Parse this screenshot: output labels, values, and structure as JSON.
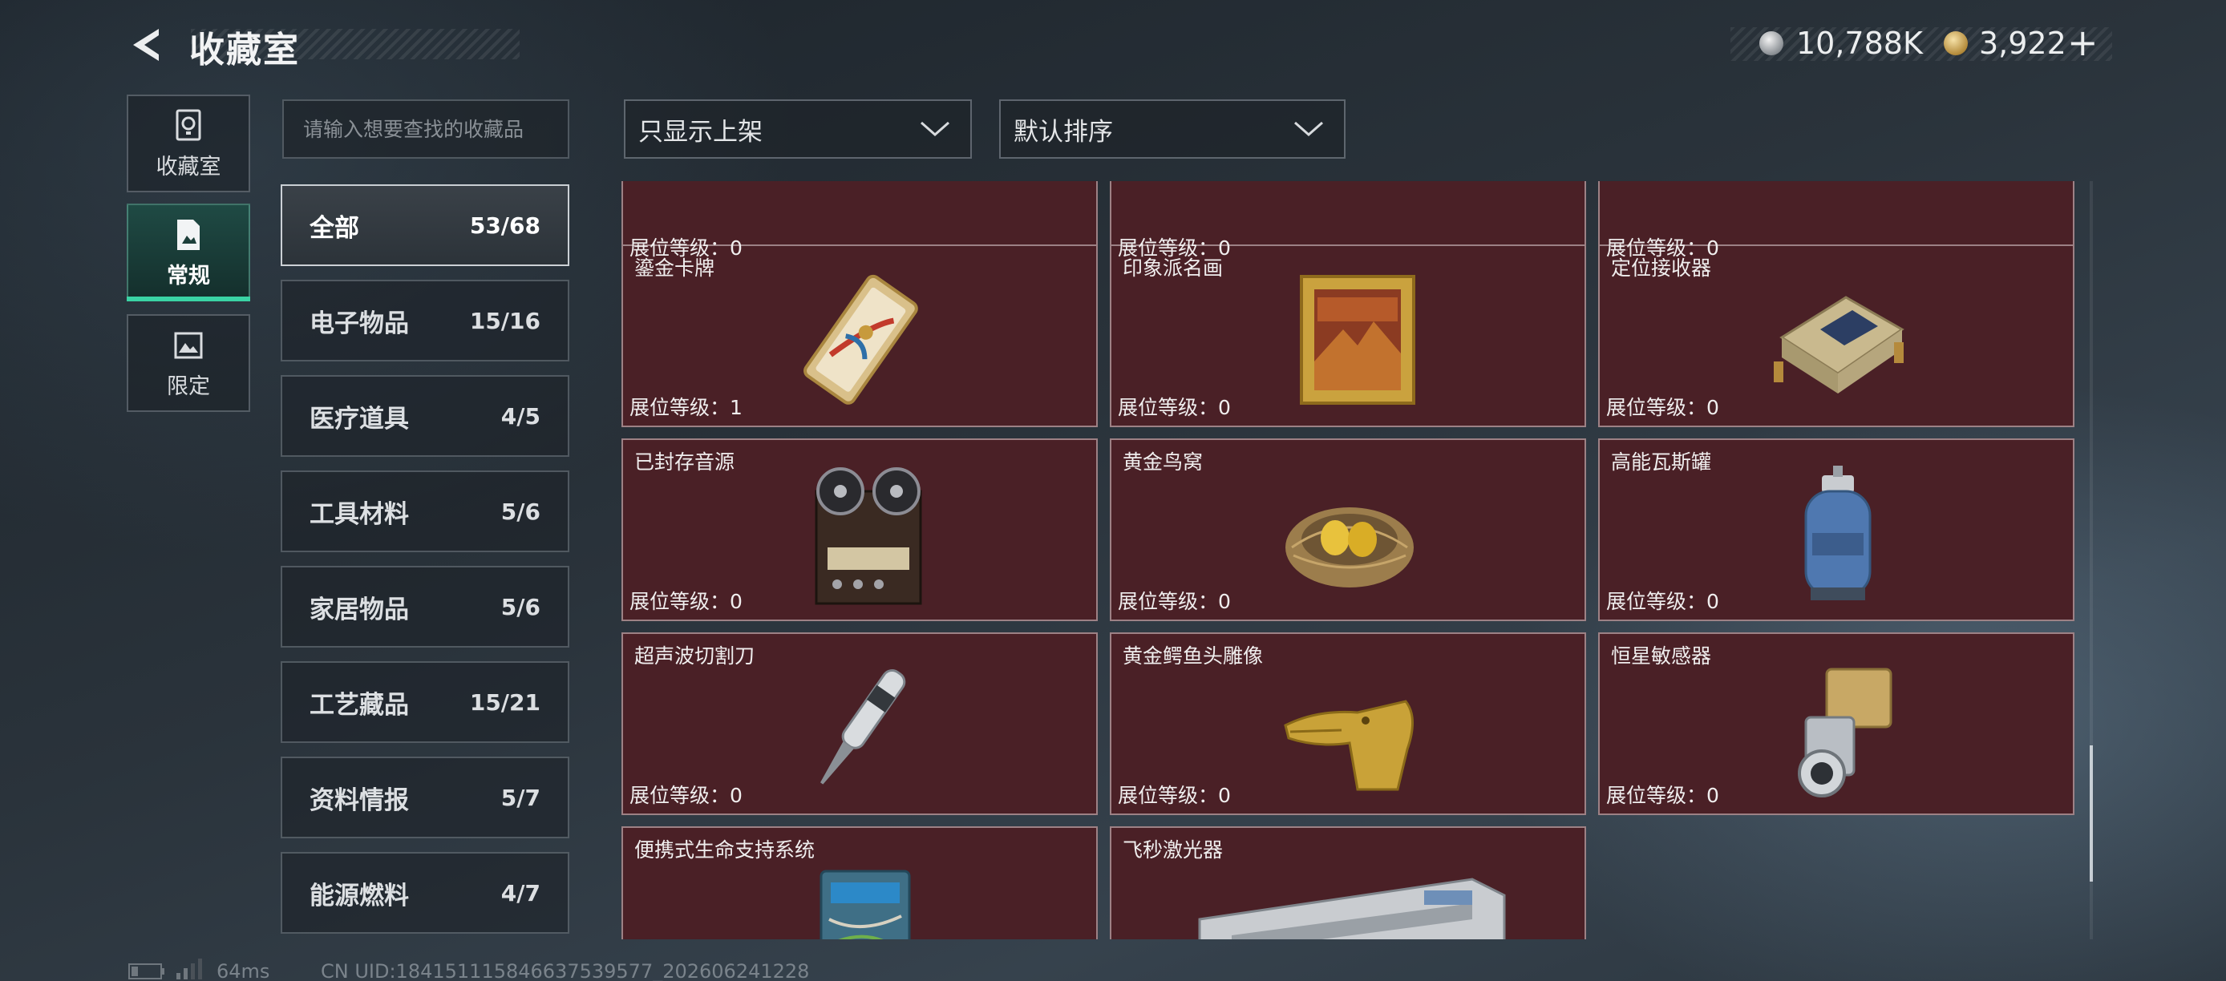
{
  "header": {
    "title": "收藏室",
    "currency": [
      {
        "icon": "silver-coin-icon",
        "value": "10,788K"
      },
      {
        "icon": "gold-coin-icon",
        "value": "3,922"
      }
    ],
    "add_label": "+"
  },
  "side_nav": [
    {
      "label": "收藏室",
      "icon": "vault-icon"
    },
    {
      "label": "常规",
      "icon": "document-icon",
      "active": true
    },
    {
      "label": "限定",
      "icon": "image-icon"
    }
  ],
  "search": {
    "placeholder": "请输入想要查找的收藏品"
  },
  "categories": [
    {
      "name": "全部",
      "count": "53/68",
      "active": true
    },
    {
      "name": "电子物品",
      "count": "15/16"
    },
    {
      "name": "医疗道具",
      "count": "4/5"
    },
    {
      "name": "工具材料",
      "count": "5/6"
    },
    {
      "name": "家居物品",
      "count": "5/6"
    },
    {
      "name": "工艺藏品",
      "count": "15/21"
    },
    {
      "name": "资料情报",
      "count": "5/7"
    },
    {
      "name": "能源燃料",
      "count": "4/7"
    }
  ],
  "filters": {
    "display": "只显示上架",
    "sort": "默认排序"
  },
  "items": [
    {
      "name": "",
      "level": "展位等级：0",
      "icon": "gold-item-icon"
    },
    {
      "name": "",
      "level": "展位等级：0",
      "icon": "mechanical-item-icon"
    },
    {
      "name": "",
      "level": "展位等级：0",
      "icon": "ring-item-icon"
    },
    {
      "name": "鎏金卡牌",
      "level": "展位等级：1",
      "icon": "gilded-card-icon"
    },
    {
      "name": "印象派名画",
      "level": "展位等级：0",
      "icon": "painting-icon"
    },
    {
      "name": "定位接收器",
      "level": "展位等级：0",
      "icon": "receiver-icon"
    },
    {
      "name": "已封存音源",
      "level": "展位等级：0",
      "icon": "tape-recorder-icon"
    },
    {
      "name": "黄金鸟窝",
      "level": "展位等级：0",
      "icon": "golden-nest-icon"
    },
    {
      "name": "高能瓦斯罐",
      "level": "展位等级：0",
      "icon": "gas-canister-icon"
    },
    {
      "name": "超声波切割刀",
      "level": "展位等级：0",
      "icon": "ultrasonic-knife-icon"
    },
    {
      "name": "黄金鳄鱼头雕像",
      "level": "展位等级：0",
      "icon": "crocodile-statue-icon"
    },
    {
      "name": "恒星敏感器",
      "level": "展位等级：0",
      "icon": "star-sensor-icon"
    },
    {
      "name": "便携式生命支持系统",
      "level": "",
      "icon": "life-support-icon"
    },
    {
      "name": "飞秒激光器",
      "level": "",
      "icon": "femtosecond-laser-icon"
    }
  ],
  "status_bar": {
    "ping": "64ms",
    "uid": "CN UID:18415111584663753957​7_202606241228"
  }
}
